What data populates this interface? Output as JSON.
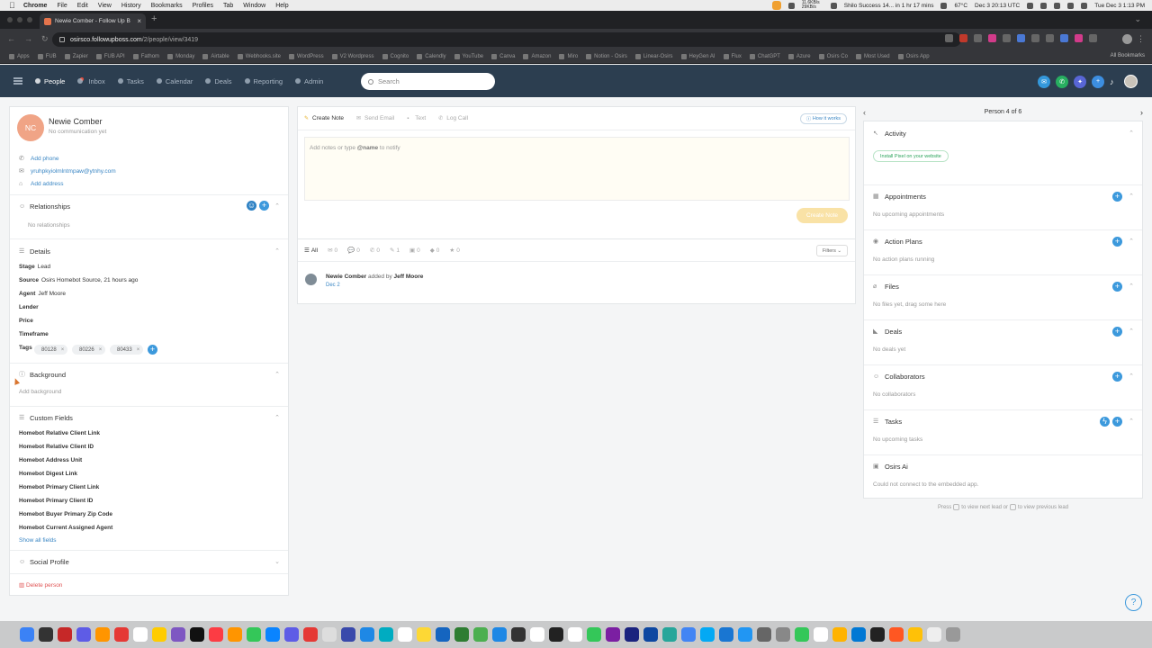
{
  "macbar": {
    "app": "Chrome",
    "menus": [
      "File",
      "Edit",
      "View",
      "History",
      "Bookmarks",
      "Profiles",
      "Tab",
      "Window",
      "Help"
    ],
    "net": "11.6KB/s 29KB/s",
    "reminder": "Shilo Success 14... in 1 hr 17 mins",
    "temp": "67°C",
    "utc": "Dec 3  20:13 UTC",
    "clock": "Tue Dec 3  1:13 PM"
  },
  "browser": {
    "tab_title": "Newie Comber - Follow Up B",
    "url_host": "osirsco.followupboss.com",
    "url_path": "/2/people/view/3419",
    "bookmarks": [
      "Apps",
      "FUB",
      "Zapier",
      "FUB API",
      "Fathom",
      "Monday",
      "Airtable",
      "Webhooks.site",
      "WordPress",
      "V2 Wordpress",
      "Cognito",
      "Calendly",
      "YouTube",
      "Canva",
      "Amazon",
      "Miro",
      "Notion - Osirs",
      "Linear-Osirs",
      "HeyGen AI",
      "Flux",
      "ChatGPT",
      "Azure",
      "Osirs Co",
      "Most Used",
      "Osirs App"
    ],
    "all_bookmarks": "All Bookmarks"
  },
  "appnav": {
    "items": [
      {
        "label": "People",
        "active": true
      },
      {
        "label": "Inbox",
        "active": false,
        "badge": true
      },
      {
        "label": "Tasks",
        "active": false
      },
      {
        "label": "Calendar",
        "active": false
      },
      {
        "label": "Deals",
        "active": false
      },
      {
        "label": "Reporting",
        "active": false
      },
      {
        "label": "Admin",
        "active": false
      }
    ],
    "search_placeholder": "Search",
    "colors": {
      "bar": "#2c3e50",
      "accent": "#3c99dc"
    }
  },
  "person": {
    "initials": "NC",
    "name": "Newie Comber",
    "comm_status": "No communication yet",
    "add_phone": "Add phone",
    "email": "yruhpkyiolmlntmpaw@ytnhy.com",
    "add_address": "Add address"
  },
  "relationships": {
    "title": "Relationships",
    "empty": "No relationships"
  },
  "details": {
    "title": "Details",
    "stage_label": "Stage",
    "stage": "Lead",
    "source_label": "Source",
    "source": "Osirs Homebot Source, 21 hours ago",
    "agent_label": "Agent",
    "agent": "Jeff Moore",
    "lender_label": "Lender",
    "price_label": "Price",
    "timeframe_label": "Timeframe",
    "tags_label": "Tags",
    "tags": [
      "80128",
      "80226",
      "80433"
    ]
  },
  "background": {
    "title": "Background",
    "add": "Add background"
  },
  "custom_fields": {
    "title": "Custom Fields",
    "fields": [
      "Homebot Relative Client Link",
      "Homebot Relative Client ID",
      "Homebot Address Unit",
      "Homebot Digest Link",
      "Homebot Primary Client Link",
      "Homebot Primary Client ID",
      "Homebot Buyer Primary Zip Code",
      "Homebot Current Assigned Agent"
    ],
    "show_all": "Show all fields"
  },
  "social": {
    "title": "Social Profile"
  },
  "delete_label": "Delete person",
  "composer": {
    "tabs": [
      "Create Note",
      "Send Email",
      "Text",
      "Log Call"
    ],
    "how_it_works": "How it works",
    "placeholder_pre": "Add notes or type ",
    "placeholder_name": "@name",
    "placeholder_post": " to notify",
    "submit": "Create Note"
  },
  "feed": {
    "tabs": [
      {
        "icon": "☰",
        "label": "All"
      },
      {
        "icon": "✉",
        "label": "0"
      },
      {
        "icon": "💬",
        "label": "0"
      },
      {
        "icon": "✆",
        "label": "0"
      },
      {
        "icon": "✎",
        "label": "1"
      },
      {
        "icon": "▣",
        "label": "0"
      },
      {
        "icon": "◆",
        "label": "0"
      },
      {
        "icon": "★",
        "label": "0"
      }
    ],
    "filters": "Filters",
    "entry_subject": "Newie Comber",
    "entry_action": " added by ",
    "entry_actor": "Jeff Moore",
    "entry_date": "Dec 2"
  },
  "sidebar": {
    "pager": "Person 4 of 6",
    "activity": "Activity",
    "install_pixel": "Install Pixel on your website",
    "sections": [
      {
        "title": "Appointments",
        "empty": "No upcoming appointments"
      },
      {
        "title": "Action Plans",
        "empty": "No action plans running"
      },
      {
        "title": "Files",
        "empty": "No files yet, drag some here"
      },
      {
        "title": "Deals",
        "empty": "No deals yet"
      },
      {
        "title": "Collaborators",
        "empty": "No collaborators"
      },
      {
        "title": "Tasks",
        "empty": "No upcoming tasks"
      },
      {
        "title": "Osirs Ai",
        "empty": "Could not connect to the embedded app."
      }
    ],
    "hint_pre": "Press",
    "hint_mid": "to view next lead or",
    "hint_post": "to view previous lead"
  }
}
